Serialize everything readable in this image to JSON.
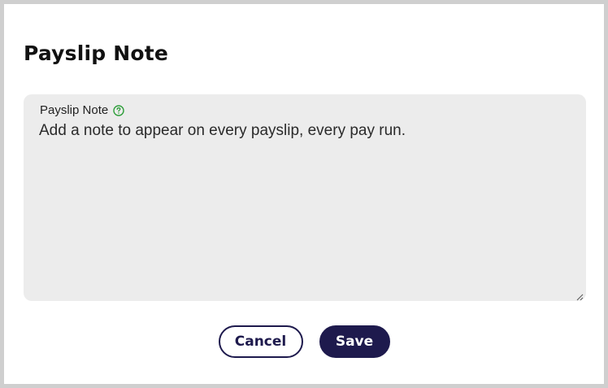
{
  "dialog": {
    "title": "Payslip Note"
  },
  "note_field": {
    "label": "Payslip Note",
    "help_icon": "help-circle-icon",
    "placeholder": "Add a note to appear on every payslip, every pay run.",
    "value": ""
  },
  "actions": {
    "cancel_label": "Cancel",
    "save_label": "Save"
  },
  "colors": {
    "primary": "#1e1a4d",
    "help_icon": "#2e9e3a",
    "field_background": "#ececec"
  }
}
